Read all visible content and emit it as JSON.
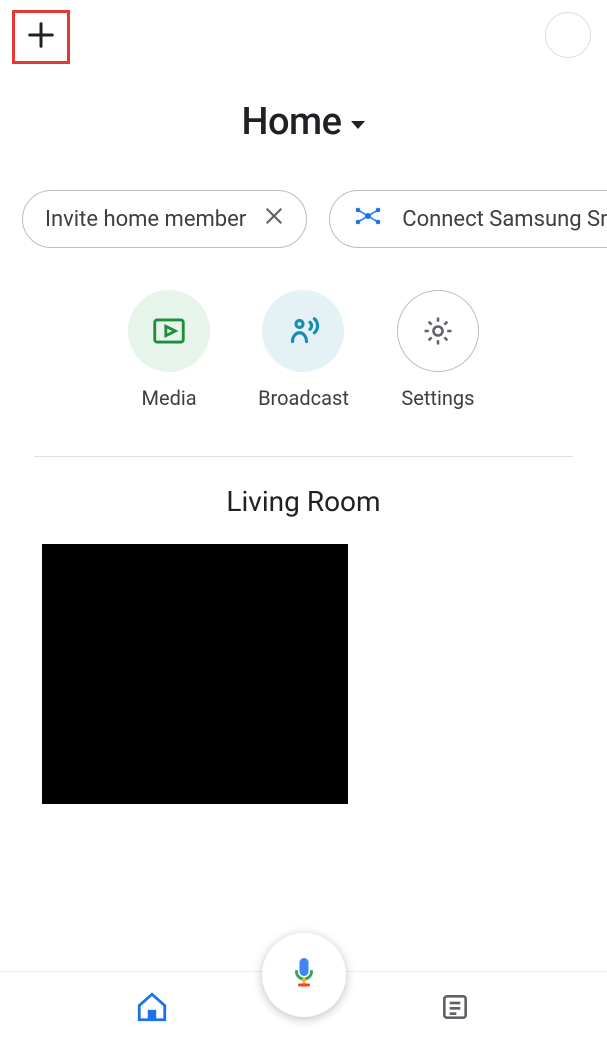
{
  "header": {
    "home_label": "Home"
  },
  "chips": [
    {
      "label": "Invite home member"
    },
    {
      "label": "Connect Samsung Sma"
    }
  ],
  "shortcuts": {
    "media": "Media",
    "broadcast": "Broadcast",
    "settings": "Settings"
  },
  "room": {
    "name": "Living Room"
  }
}
